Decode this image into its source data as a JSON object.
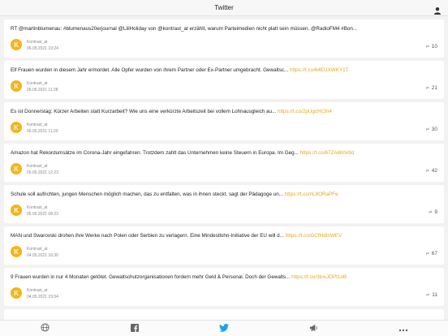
{
  "header": {
    "title": "Twitter",
    "user_icon": "user-icon"
  },
  "colors": {
    "accent": "#e6a61f",
    "logo": "#f4b51a",
    "twitter": "#1da1f2"
  },
  "tweets": [
    {
      "text": "RT @martinblumenau: #blumenaus20erjournal @LiliHoliday von @kontrast_at erzählt, warum Parteimedien nicht platt sein müssen. @RadioFM4 #Bon...",
      "link": "",
      "author": "Kontrast_at",
      "date": "06.05.2021 19:24",
      "count": "10"
    },
    {
      "text": "Elf Frauen wurden in diesem Jahr ermordet. Alle Opfer wurden von ihrem Partner oder Ex-Partner umgebracht. Gewaltsc...",
      "link": "https://t.co/64EUXWKY1T",
      "author": "Kontrast_at",
      "date": "06.05.2021 11:28",
      "count": "21"
    },
    {
      "text": "Es ist Donnerstag: Kürzer Arbeiten statt Kurzarbeit? Wie uns eine verkürzte Arbeitszeit bei vollem Lohnausgleich au...",
      "link": "https://t.co/2pUgcHCfn4",
      "author": "Kontrast_at",
      "date": "06.05.2021 11:20",
      "count": "30"
    },
    {
      "text": "Amazon hat Rekordumsätze im Corona-Jahr eingefahren. Trotzdem zahlt das Unternehmen keine Steuern in Europa. Im Geg...",
      "link": "https://t.co/67ZA8b0v9d",
      "author": "Kontrast_at",
      "date": "05.05.2021 12:23",
      "count": "42"
    },
    {
      "text": "Schule soll aufrichten, jungen Menschen möglich machen, das zu entfalten, was in ihnen steckt, sagt der Pädagoge un...",
      "link": "https://t.co/nL8ORaPFe",
      "author": "Kontrast_at",
      "date": "05.05.2021 08:23",
      "count": "9"
    },
    {
      "text": "MAN und Swarovski drohen ihre Werke nach Polen oder Serbien zu verlagern. Eine Mindestlohn-Initiative der EU will d...",
      "link": "https://t.co/GCfHdInWEV",
      "author": "Kontrast_at",
      "date": "04.05.2021 16:30",
      "count": "67"
    },
    {
      "text": "9 Frauen wurden in nur 4 Monaten getötet. Gewaltschutzorganisationen fordern mehr Geld & Personal. Doch der Gewalts...",
      "link": "https://t.co/3tnxJOPt1oB",
      "author": "Kontrast_at",
      "date": "04.05.2021 15:54",
      "count": "11"
    }
  ],
  "tabbar": {
    "items": [
      {
        "name": "web",
        "glyph": "🌐"
      },
      {
        "name": "facebook",
        "glyph": "f"
      },
      {
        "name": "twitter",
        "glyph": "🐦"
      },
      {
        "name": "announcements",
        "glyph": "📣"
      },
      {
        "name": "more",
        "glyph": "•••"
      }
    ]
  }
}
